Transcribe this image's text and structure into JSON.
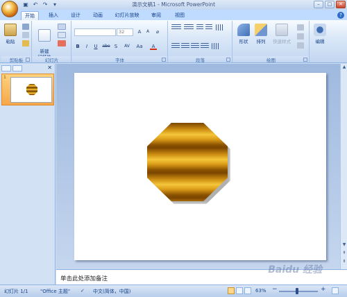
{
  "window": {
    "title": "演示文稿1 - Microsoft PowerPoint"
  },
  "tabs": [
    {
      "label": "开始"
    },
    {
      "label": "插入"
    },
    {
      "label": "设计"
    },
    {
      "label": "动画"
    },
    {
      "label": "幻灯片放映"
    },
    {
      "label": "审阅"
    },
    {
      "label": "视图"
    }
  ],
  "ribbon": {
    "clipboard": {
      "label": "剪贴板",
      "paste": "粘贴"
    },
    "slides": {
      "label": "幻灯片",
      "new_slide": "新建\n幻灯片"
    },
    "font": {
      "label": "字体",
      "size": "32",
      "bold": "B",
      "italic": "I",
      "underline": "U",
      "strike": "abe",
      "shadow": "S",
      "spacing": "AV",
      "case": "Aa",
      "color": "A",
      "grow": "A",
      "shrink": "A"
    },
    "paragraph": {
      "label": "段落"
    },
    "drawing": {
      "label": "绘图",
      "shapes": "形状",
      "arrange": "排列",
      "quick_styles": "快速样式"
    },
    "editing": {
      "label": "编辑"
    }
  },
  "slide_panel": {
    "slide_number": "1"
  },
  "notes": {
    "placeholder": "单击此处添加备注"
  },
  "status": {
    "slide": "幻灯片 1/1",
    "theme": "\"Office 主题\"",
    "language": "中文(简体，中国)",
    "zoom": "63%"
  },
  "watermark": "Baidu 经验",
  "colors": {
    "accent_orange": "#f5c63a",
    "ribbon_blue": "#bfdbff",
    "title_text": "#15428b"
  }
}
